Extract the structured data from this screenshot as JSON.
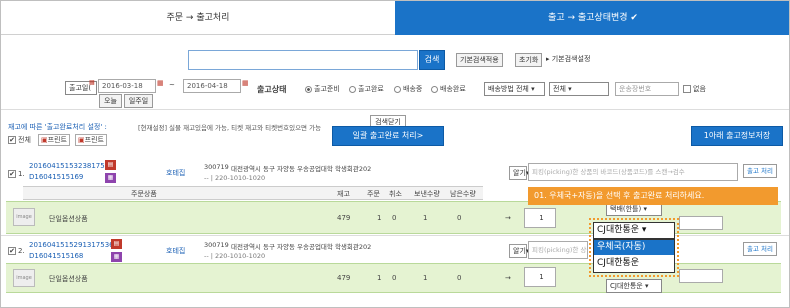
{
  "tabs": [
    {
      "label": "주문 → 출고처리"
    },
    {
      "label": "출고 → 출고상태변경 ✔"
    }
  ],
  "search": {
    "button": "검색",
    "detail_btn": "기본검색적용",
    "reset_btn": "초기화",
    "settings": "▸ 기본검색설정"
  },
  "date": {
    "field": "출고일(",
    "from": "2016-03-18",
    "to": "2016-04-18",
    "today": "오늘",
    "week": "일주일",
    "tilde": "~"
  },
  "status": {
    "label": "출고상태",
    "options": [
      "출고준비",
      "출고완료",
      "배송중",
      "배송완료"
    ],
    "delivery_method": "배송방법 전체",
    "all": "전체",
    "tracking_placeholder": "운송장번호",
    "no_tracking": "없음"
  },
  "notice": {
    "setting": "재고에 따른 '출고완료처리 설정' :",
    "desc": "[현재설정] 실물 재고있음에 가능, 티켓 재고와 티켓번호있으면 가능",
    "all": "전체",
    "print1": "프린트",
    "print2": "프린트"
  },
  "actions": {
    "collapse": "검색닫기",
    "bulk": "일괄 출고완료 처리>",
    "save": "1아래 출고정보저장"
  },
  "orders": [
    {
      "no": "2016041515323817537",
      "sub": "D16041515169",
      "buyer": "호테집",
      "zip": "300719",
      "addr": "대전광역시 동구 자양동 우송공업대학 학생회관202",
      "phone": "-- | 220-1010-1020",
      "barcode": "피킹(picking)한 상품의 바코드(상품코드)를 스캔→검수",
      "out_btn": "출고 처리"
    },
    {
      "no": "2016041515291317536",
      "sub": "D16041515168",
      "buyer": "호테집",
      "zip": "300719",
      "addr": "대전광역시 동구 자양동 우송공업대학 학생회관202",
      "phone": "-- | 220-1010-1020",
      "barcode": "피킹(picking)한 상품의 바코드(상품코드)를 스캔→검수",
      "out_btn": "출고 처리"
    }
  ],
  "table": {
    "headers": [
      "주문상품",
      "재고",
      "주문",
      "취소",
      "보낸수량",
      "남은수량"
    ],
    "rows": [
      {
        "product": "단일옵션상품",
        "stock": "479",
        "order": "1",
        "cancel": "0",
        "sent": "1",
        "remain": "0",
        "qty": "1"
      },
      {
        "product": "단일옵션상품",
        "stock": "479",
        "order": "1",
        "cancel": "0",
        "sent": "1",
        "remain": "0",
        "qty": "1"
      }
    ]
  },
  "misc": {
    "num1": "1.",
    "num2": "2.",
    "arrow": "→",
    "img": "image",
    "more": "알기▾"
  },
  "callout": {
    "text": "01. 우체국+자동)을 선택 후 출고완료 처리하세요."
  },
  "dropdown": {
    "selected": "CJ대한통운",
    "options": [
      "우체국(자동)",
      "CJ대한통운"
    ],
    "row1_sel": "택배(한틀)",
    "row2_sel": "CJ대한통운"
  },
  "colors": {
    "blue": "#1a73c8",
    "orange": "#f29a2e",
    "green": "#e5f3d2"
  }
}
